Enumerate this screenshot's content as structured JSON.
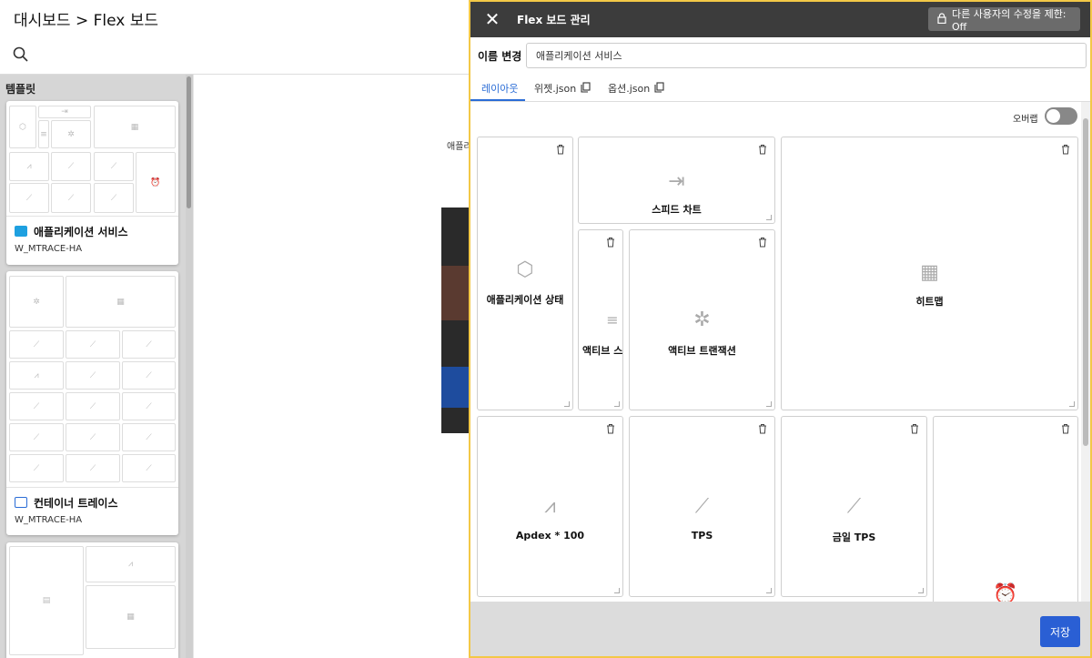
{
  "header": {
    "title": "대시보드 > Flex 보드"
  },
  "templates": {
    "heading": "템플릿",
    "cards": [
      {
        "name": "애플리케이션 서비스",
        "sub": "W_MTRACE-HA"
      },
      {
        "name": "컨테이너 트레이스",
        "sub": "W_MTRACE-HA"
      }
    ]
  },
  "canvas": {
    "label": "애플리"
  },
  "modal": {
    "title": "Flex 보드 관리",
    "restrict": "다른 사용자의 수정을 제한: Off",
    "rename_label": "이름 변경",
    "rename_value": "애플리케이션 서비스",
    "tabs": [
      "레이아웃",
      "위젯.json",
      "옵션.json"
    ],
    "overlap_label": "오버랩",
    "overlap_on": false,
    "save": "저장",
    "widgets": [
      {
        "label": "애플리케이션 상태",
        "icon": "hexagons-icon"
      },
      {
        "label": "스피드 차트",
        "icon": "speed-chart-icon"
      },
      {
        "label": "액티브 스",
        "icon": "active-bars-icon"
      },
      {
        "label": "액티브 트랜잭션",
        "icon": "wheel-icon"
      },
      {
        "label": "히트맵",
        "icon": "grid-icon"
      },
      {
        "label": "Apdex * 100",
        "icon": "apdex-icon"
      },
      {
        "label": "TPS",
        "icon": "line-chart-icon"
      },
      {
        "label": "금일 TPS",
        "icon": "line-chart-icon"
      }
    ]
  }
}
